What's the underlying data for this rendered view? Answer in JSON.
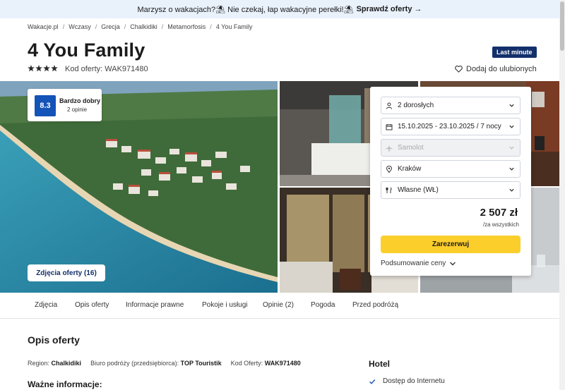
{
  "promo": {
    "text": "Marzysz o wakacjach?⛱ Nie czekaj, łap wakacyjne perełki!⛱",
    "link": "Sprawdź oferty →"
  },
  "breadcrumb": [
    "Wakacje.pl",
    "Wczasy",
    "Grecja",
    "Chalkidiki",
    "Metamorfosis",
    "4 You Family"
  ],
  "hotel": {
    "name": "4 You Family",
    "badge": "Last minute",
    "stars": 4,
    "offer_code_label": "Kod oferty: WAK971480",
    "favorite_label": "Dodaj do ulubionych"
  },
  "rating": {
    "score": "8.3",
    "label": "Bardzo dobry",
    "count": "2 opinie"
  },
  "gallery": {
    "photos_button": "Zdjęcia oferty (16)"
  },
  "booking": {
    "travelers": "2 dorosłych",
    "dates": "15.10.2025 - 23.10.2025 / 7 nocy",
    "transport": "Samolot",
    "departure": "Kraków",
    "board": "Własne (WŁ)",
    "price": "2 507 zł",
    "price_note": "/za wszystkich",
    "book_label": "Zarezerwuj",
    "summary_label": "Podsumowanie ceny"
  },
  "tabs": [
    "Zdjęcia",
    "Opis oferty",
    "Informacje prawne",
    "Pokoje i usługi",
    "Opinie (2)",
    "Pogoda",
    "Przed podróżą"
  ],
  "description": {
    "title": "Opis oferty",
    "region_label": "Region:",
    "region_value": "Chalkidiki",
    "organizer_label": "Biuro podróży (przedsiębiorca):",
    "organizer_value": "TOP Touristik",
    "code_label": "Kod Oferty:",
    "code_value": "WAK971480",
    "important": "Ważne informacje:"
  },
  "hotel_features": {
    "title": "Hotel",
    "items": [
      "Dostęp do Internetu"
    ]
  },
  "colors": {
    "brand_navy": "#13306b",
    "rating_blue": "#1453b8",
    "cta_yellow": "#fcce2c",
    "promo_bg": "#e9f1fb"
  }
}
